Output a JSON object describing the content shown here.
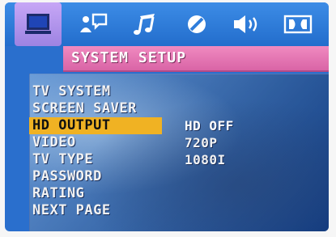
{
  "tabs": [
    {
      "icon": "monitor-icon",
      "active": true
    },
    {
      "icon": "person-speech-icon",
      "active": false
    },
    {
      "icon": "music-note-icon",
      "active": false
    },
    {
      "icon": "circle-slash-icon",
      "active": false
    },
    {
      "icon": "speaker-icon",
      "active": false
    },
    {
      "icon": "dolby-icon",
      "active": false
    }
  ],
  "title": "SYSTEM SETUP",
  "menu": {
    "items": [
      {
        "label": "TV SYSTEM"
      },
      {
        "label": "SCREEN SAVER"
      },
      {
        "label": "HD OUTPUT"
      },
      {
        "label": "VIDEO"
      },
      {
        "label": "TV TYPE"
      },
      {
        "label": "PASSWORD"
      },
      {
        "label": "RATING"
      },
      {
        "label": "NEXT PAGE"
      }
    ],
    "selected_label": "HD OUTPUT"
  },
  "options": {
    "items": [
      {
        "label": "HD OFF"
      },
      {
        "label": "720P"
      },
      {
        "label": "1080I"
      }
    ]
  },
  "colors": {
    "tabbar": "#2f7ddb",
    "active_tab": "#b295ee",
    "titlebar": "#e77bb5",
    "highlight": "#f0b223",
    "text": "#f2f2f2"
  }
}
